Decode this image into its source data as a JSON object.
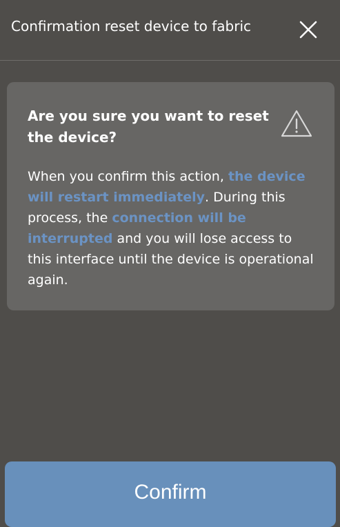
{
  "dialog": {
    "title": "Confirmation reset device to fabric",
    "close_icon": "close-icon"
  },
  "warning_card": {
    "heading": "Are you sure you want to reset the device?",
    "icon": "warning-triangle-icon",
    "body": {
      "part1": "When you confirm this action, ",
      "highlight1": "the device will restart immediately",
      "part2": ". During this process, the ",
      "highlight2": "connection will be interrupted",
      "part3": " and you will lose access to this interface until the device is operational again."
    },
    "highlight_color": "#6b93c4"
  },
  "actions": {
    "confirm_label": "Confirm",
    "confirm_color": "#6890bb"
  },
  "colors": {
    "background": "#4f4d4a",
    "card": "#676664"
  }
}
